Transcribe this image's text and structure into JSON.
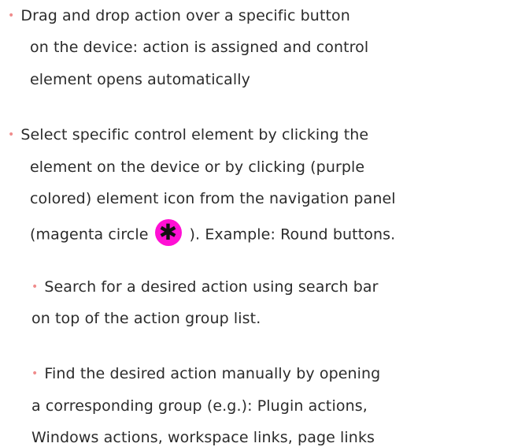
{
  "items": [
    {
      "bullet": "•",
      "lines": [
        "Drag and drop action over a specific button",
        "on the device: action is assigned and control",
        "element opens automatically"
      ]
    },
    {
      "bullet": "•",
      "lines": [
        "Select specific control element by clicking the",
        "element on the device or by clicking (purple",
        "colored) element icon from the navigation panel"
      ],
      "last_line_prefix": "(magenta circle",
      "icon_glyph": "✱",
      "icon_name": "asterisk-icon",
      "icon_color": "#ff10d4",
      "last_line_suffix": "). Example: Round buttons."
    }
  ],
  "subitems": [
    {
      "bullet": "•",
      "lines": [
        "Search for a desired action using search bar",
        "on top of the action group list."
      ]
    },
    {
      "bullet": "•",
      "lines": [
        "Find the desired action manually by opening",
        "a corresponding group (e.g.): Plugin actions,",
        "Windows actions, workspace links, page links"
      ]
    }
  ]
}
